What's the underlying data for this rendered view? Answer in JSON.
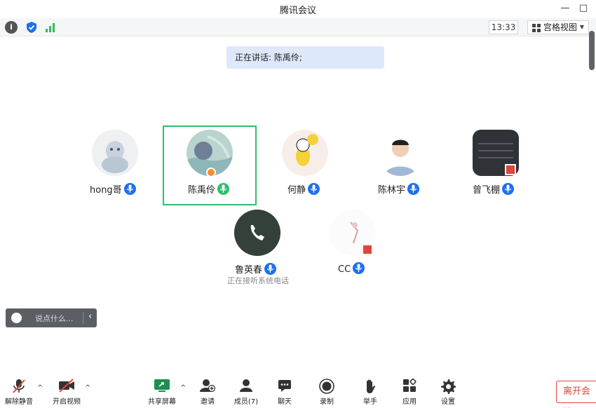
{
  "window": {
    "title": "腾讯会议",
    "minimize_glyph": "—",
    "maximize_glyph": "□"
  },
  "status": {
    "icons": [
      "info-icon",
      "shield-icon",
      "signal-icon"
    ],
    "time": "13:33",
    "view_label": "宫格视图",
    "view_caret": "▼"
  },
  "speaking": {
    "text": "正在讲话: 陈禹伶;"
  },
  "participants": [
    {
      "name": "hong哥",
      "mic": "mic-on"
    },
    {
      "name": "陈禹伶",
      "mic": "mic-speaking",
      "active": true
    },
    {
      "name": "何静",
      "mic": "mic-on"
    },
    {
      "name": "陈林宇",
      "mic": "mic-on"
    },
    {
      "name": "曾飞棚",
      "mic": "mic-on"
    },
    {
      "name": "鲁英春",
      "mic": "mic-on",
      "status": "正在接听系统电话"
    },
    {
      "name": "CC",
      "mic": "mic-on"
    }
  ],
  "chat": {
    "placeholder": "说点什么...",
    "collapse_glyph": "‹"
  },
  "toolbar": {
    "unmute": "解除静音",
    "start_video": "开启视频",
    "share_screen": "共享屏幕",
    "invite": "邀请",
    "members": "成员(7)",
    "chat": "聊天",
    "record": "录制",
    "raise_hand": "举手",
    "apps": "应用",
    "settings": "设置",
    "leave": "离开会议",
    "caret": "^"
  },
  "colors": {
    "accent": "#1d6ff2",
    "active_border": "#2fbf6b",
    "leave": "#e3443a",
    "speaking_bg": "#dde9fb"
  }
}
